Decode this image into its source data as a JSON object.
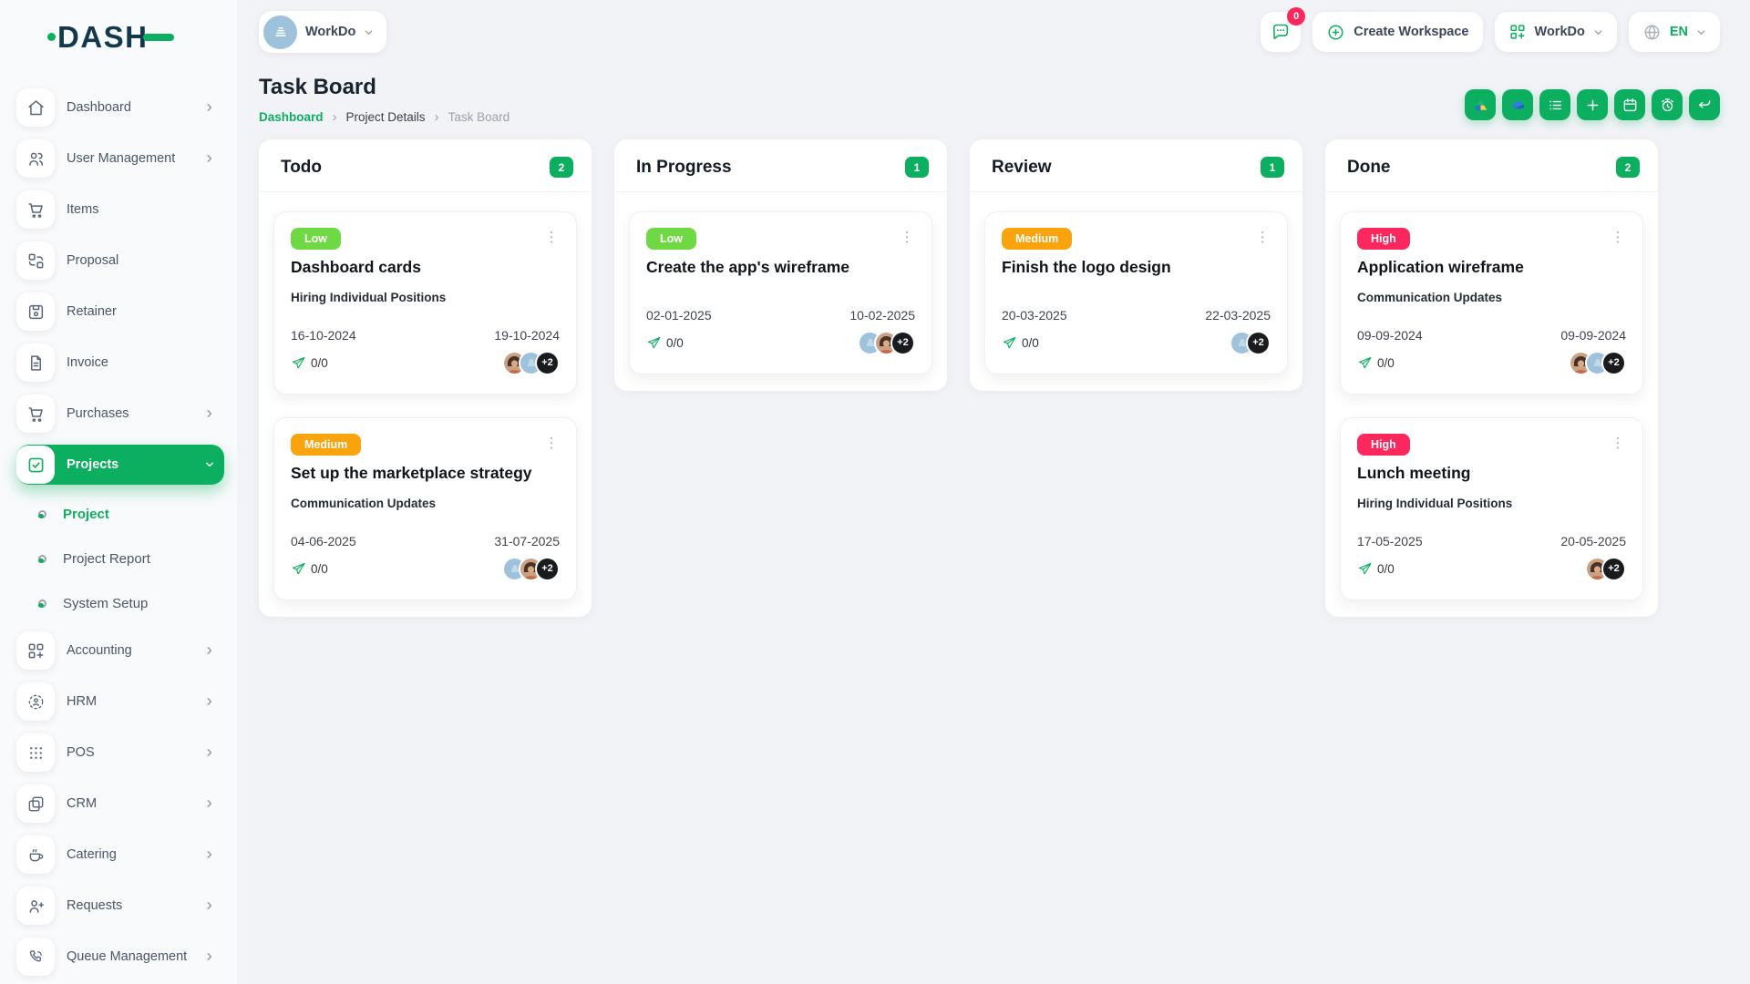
{
  "brand": {
    "logo_text": "DASH"
  },
  "colors": {
    "primary": "#0CAF60",
    "priority": {
      "Low": "#6FD943",
      "Medium": "#F9A30D",
      "High": "#FC275C"
    },
    "notification": "#FC275C",
    "chip_dark": "#191B1E"
  },
  "topbar": {
    "workspace_selector_label": "WorkDo",
    "messages_count": "0",
    "create_workspace_label": "Create Workspace",
    "app_menu_label": "WorkDo",
    "language_code": "EN"
  },
  "sidebar": {
    "items": [
      {
        "label": "Dashboard",
        "icon": "home-icon",
        "chevron": true
      },
      {
        "label": "User Management",
        "icon": "users-icon",
        "chevron": true
      },
      {
        "label": "Items",
        "icon": "cart-icon",
        "chevron": false
      },
      {
        "label": "Proposal",
        "icon": "proposal-icon",
        "chevron": false
      },
      {
        "label": "Retainer",
        "icon": "retainer-icon",
        "chevron": false
      },
      {
        "label": "Invoice",
        "icon": "invoice-icon",
        "chevron": false
      },
      {
        "label": "Purchases",
        "icon": "cart-icon",
        "chevron": true
      },
      {
        "label": "Projects",
        "icon": "check-square-icon",
        "chevron": true,
        "active": true,
        "expanded": true
      },
      {
        "label": "Accounting",
        "icon": "grid-plus-icon",
        "chevron": true
      },
      {
        "label": "HRM",
        "icon": "hrm-icon",
        "chevron": true
      },
      {
        "label": "POS",
        "icon": "dots-grid-icon",
        "chevron": true
      },
      {
        "label": "CRM",
        "icon": "crm-icon",
        "chevron": true
      },
      {
        "label": "Catering",
        "icon": "coffee-icon",
        "chevron": true
      },
      {
        "label": "Requests",
        "icon": "user-plus-icon",
        "chevron": true
      },
      {
        "label": "Queue Management",
        "icon": "phone-icon",
        "chevron": true
      }
    ],
    "projects_submenu": [
      {
        "label": "Project",
        "active": true
      },
      {
        "label": "Project Report",
        "active": false
      },
      {
        "label": "System Setup",
        "active": false
      }
    ]
  },
  "page": {
    "title": "Task Board",
    "breadcrumb": [
      "Dashboard",
      "Project Details",
      "Task Board"
    ]
  },
  "toolbar": {
    "buttons": [
      "google-drive-button",
      "onedrive-button",
      "list-view-button",
      "add-task-button",
      "calendar-button",
      "timer-button",
      "back-button"
    ]
  },
  "board": {
    "columns": [
      {
        "name": "Todo",
        "count": "2",
        "tasks": [
          {
            "priority": "Low",
            "title": "Dashboard cards",
            "milestone": "Hiring Individual Positions",
            "start_date": "16-10-2024",
            "end_date": "19-10-2024",
            "progress": "0/0",
            "avatars": [
              "woman-photo",
              "workdo-logo"
            ],
            "extra_members": "+2"
          },
          {
            "priority": "Medium",
            "title": "Set up the marketplace strategy",
            "milestone": "Communication Updates",
            "start_date": "04-06-2025",
            "end_date": "31-07-2025",
            "progress": "0/0",
            "avatars": [
              "workdo-logo",
              "woman-photo"
            ],
            "extra_members": "+2"
          }
        ]
      },
      {
        "name": "In Progress",
        "count": "1",
        "tasks": [
          {
            "priority": "Low",
            "title": "Create the app's wireframe",
            "milestone": "",
            "start_date": "02-01-2025",
            "end_date": "10-02-2025",
            "progress": "0/0",
            "avatars": [
              "workdo-logo",
              "woman-photo"
            ],
            "extra_members": "+2"
          }
        ]
      },
      {
        "name": "Review",
        "count": "1",
        "tasks": [
          {
            "priority": "Medium",
            "title": "Finish the logo design",
            "milestone": "",
            "start_date": "20-03-2025",
            "end_date": "22-03-2025",
            "progress": "0/0",
            "avatars": [
              "workdo-logo"
            ],
            "extra_members": "+2"
          }
        ]
      },
      {
        "name": "Done",
        "count": "2",
        "tasks": [
          {
            "priority": "High",
            "title": "Application wireframe",
            "milestone": "Communication Updates",
            "start_date": "09-09-2024",
            "end_date": "09-09-2024",
            "progress": "0/0",
            "avatars": [
              "woman-photo",
              "workdo-logo"
            ],
            "extra_members": "+2"
          },
          {
            "priority": "High",
            "title": "Lunch meeting",
            "milestone": "Hiring Individual Positions",
            "start_date": "17-05-2025",
            "end_date": "20-05-2025",
            "progress": "0/0",
            "avatars": [
              "woman-photo"
            ],
            "extra_members": "+2"
          }
        ]
      }
    ]
  }
}
